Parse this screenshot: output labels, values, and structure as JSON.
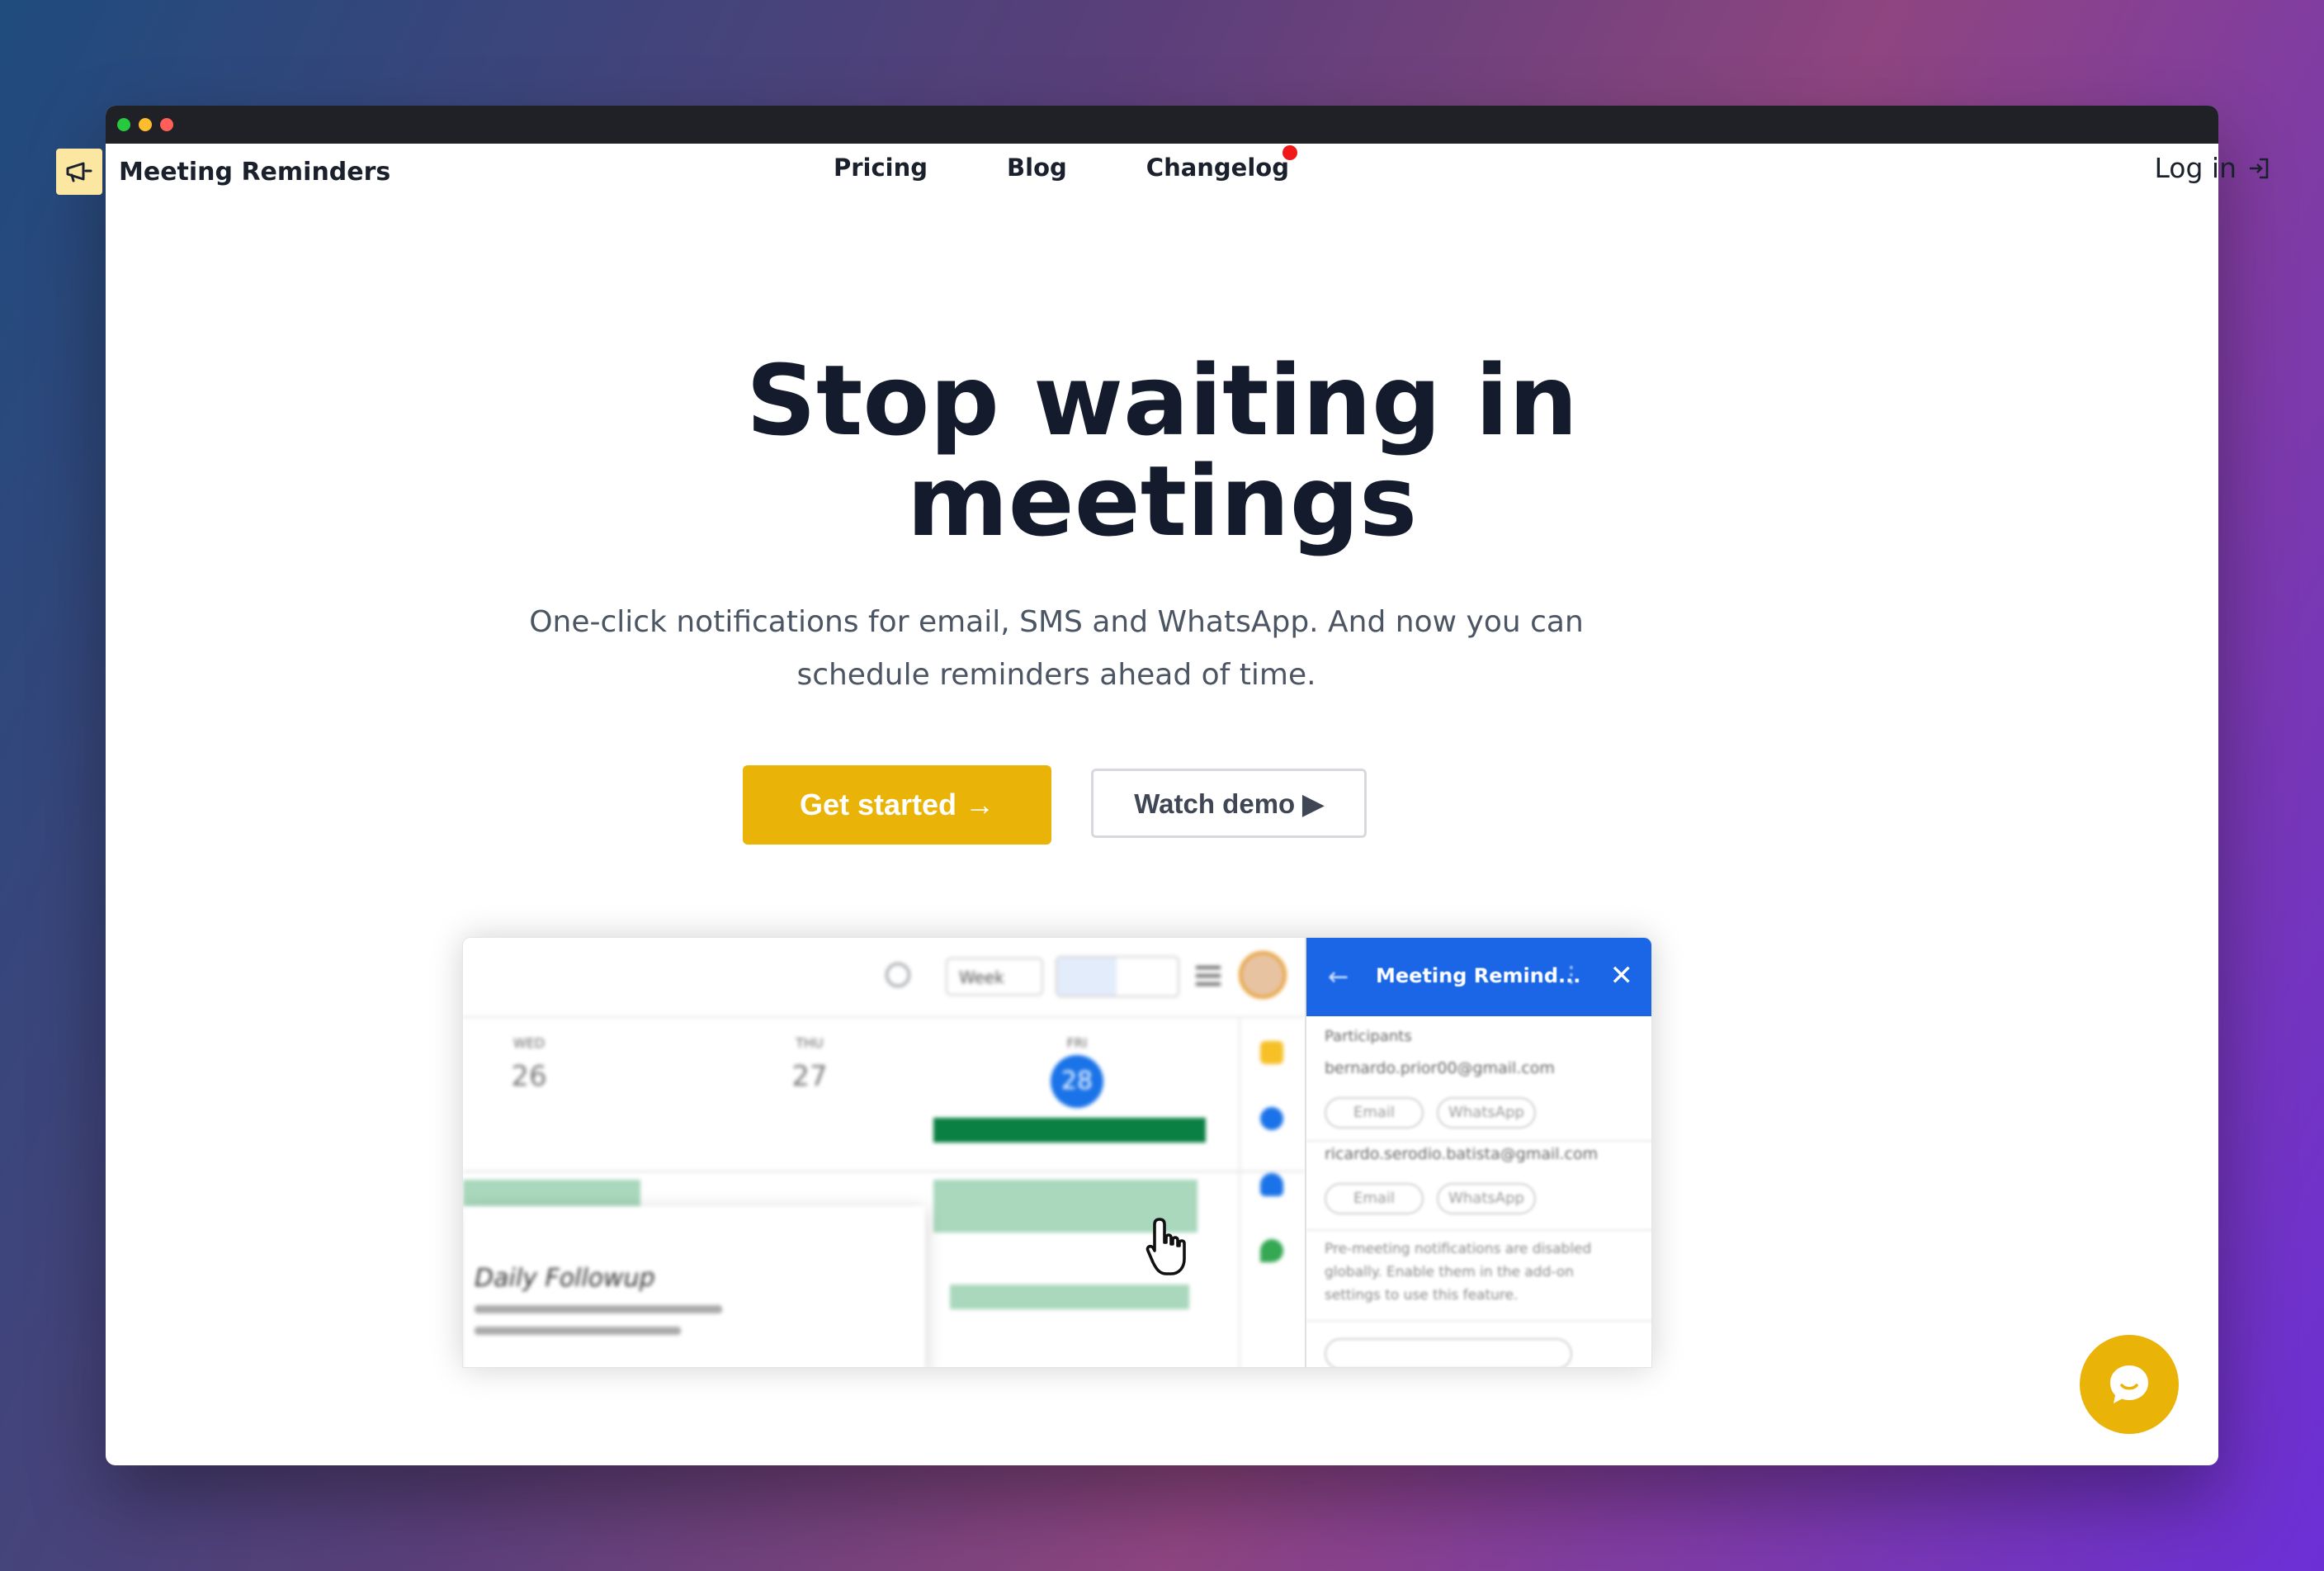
{
  "window": {
    "controls": [
      "green",
      "yellow",
      "red"
    ]
  },
  "nav": {
    "brand": "Meeting Reminders",
    "brand_icon": "megaphone-icon",
    "links": [
      "Pricing",
      "Blog",
      "Changelog"
    ],
    "changelog_has_notification": true,
    "login_label": "Log in",
    "login_icon": "login-icon"
  },
  "hero": {
    "title_line1": "Stop waiting in",
    "title_line2": "meetings",
    "subtitle": "One-click notifications for email, SMS and WhatsApp. And now you can schedule reminders ahead of time.",
    "primary_cta": "Get started →",
    "secondary_cta": "Watch demo ▶"
  },
  "demo": {
    "calendar": {
      "view_select": "Week",
      "days": [
        {
          "name": "WED",
          "num": "26"
        },
        {
          "name": "THU",
          "num": "27"
        },
        {
          "name": "FRI",
          "num": "28"
        }
      ],
      "event_title": "Daily Followup"
    },
    "panel": {
      "title": "Meeting Remind...",
      "participants_label": "Participants",
      "participants": [
        {
          "email": "bernardo.prior00@gmail.com",
          "options": [
            "Email",
            "WhatsApp"
          ]
        },
        {
          "email": "ricardo.serodio.batista@gmail.com",
          "options": [
            "Email",
            "WhatsApp"
          ]
        }
      ],
      "note": "Pre-meeting notifications are disabled globally. Enable them in the add-on settings to use this feature."
    }
  },
  "chat": {
    "icon": "chat-icon"
  },
  "colors": {
    "accent": "#eab308",
    "heading": "#141b2d",
    "panel_header": "#1a66e6"
  }
}
